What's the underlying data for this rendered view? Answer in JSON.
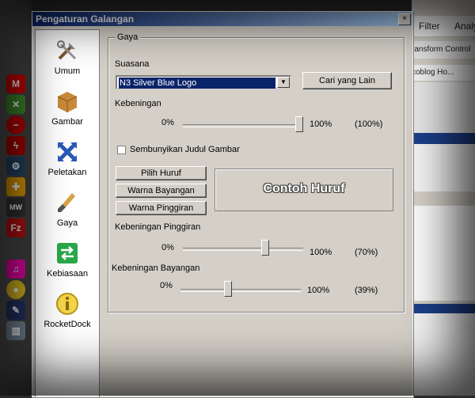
{
  "dialog": {
    "title": "Pengaturan Galangan",
    "close_label": "×"
  },
  "sidebar": {
    "items": [
      {
        "label": "Umum",
        "icon": "tools-icon"
      },
      {
        "label": "Gambar",
        "icon": "box-icon"
      },
      {
        "label": "Peletakan",
        "icon": "arrows-icon"
      },
      {
        "label": "Gaya",
        "icon": "brush-icon"
      },
      {
        "label": "Kebiasaan",
        "icon": "switch-icon"
      },
      {
        "label": "RocketDock",
        "icon": "info-icon"
      }
    ]
  },
  "style": {
    "group_label": "Gaya",
    "theme_label": "Suasana",
    "theme_value": "N3 Silver Blue Logo",
    "find_more_label": "Cari yang Lain",
    "opacity_label": "Kebeningan",
    "opacity_min": "0%",
    "opacity_max": "100%",
    "opacity_value": "(100%)",
    "opacity_level": 100,
    "hide_titles_label": "Sembunyikan Judul Gambar",
    "hide_titles_checked": false,
    "choose_font_label": "Pilih Huruf",
    "shadow_color_label": "Warna Bayangan",
    "outline_color_label": "Warna Pinggiran",
    "font_preview": "Contoh Huruf",
    "outline_opacity_label": "Kebeningan Pinggiran",
    "outline_min": "0%",
    "outline_max": "100%",
    "outline_value": "(70%)",
    "outline_level": 70,
    "shadow_opacity_label": "Kebeningan Bayangan",
    "shadow_min": "0%",
    "shadow_max": "100%",
    "shadow_value": "(39%)",
    "shadow_level": 39
  },
  "background_app": {
    "menu_filter": "Filter",
    "menu_analysis": "Analy",
    "toolbar_text": "ransform Control",
    "tab_text": "coblog Ho..."
  },
  "colors": {
    "title_start": "#0a246a",
    "title_end": "#a6caf0",
    "face": "#d4d0c8",
    "selection": "#0a246a"
  }
}
